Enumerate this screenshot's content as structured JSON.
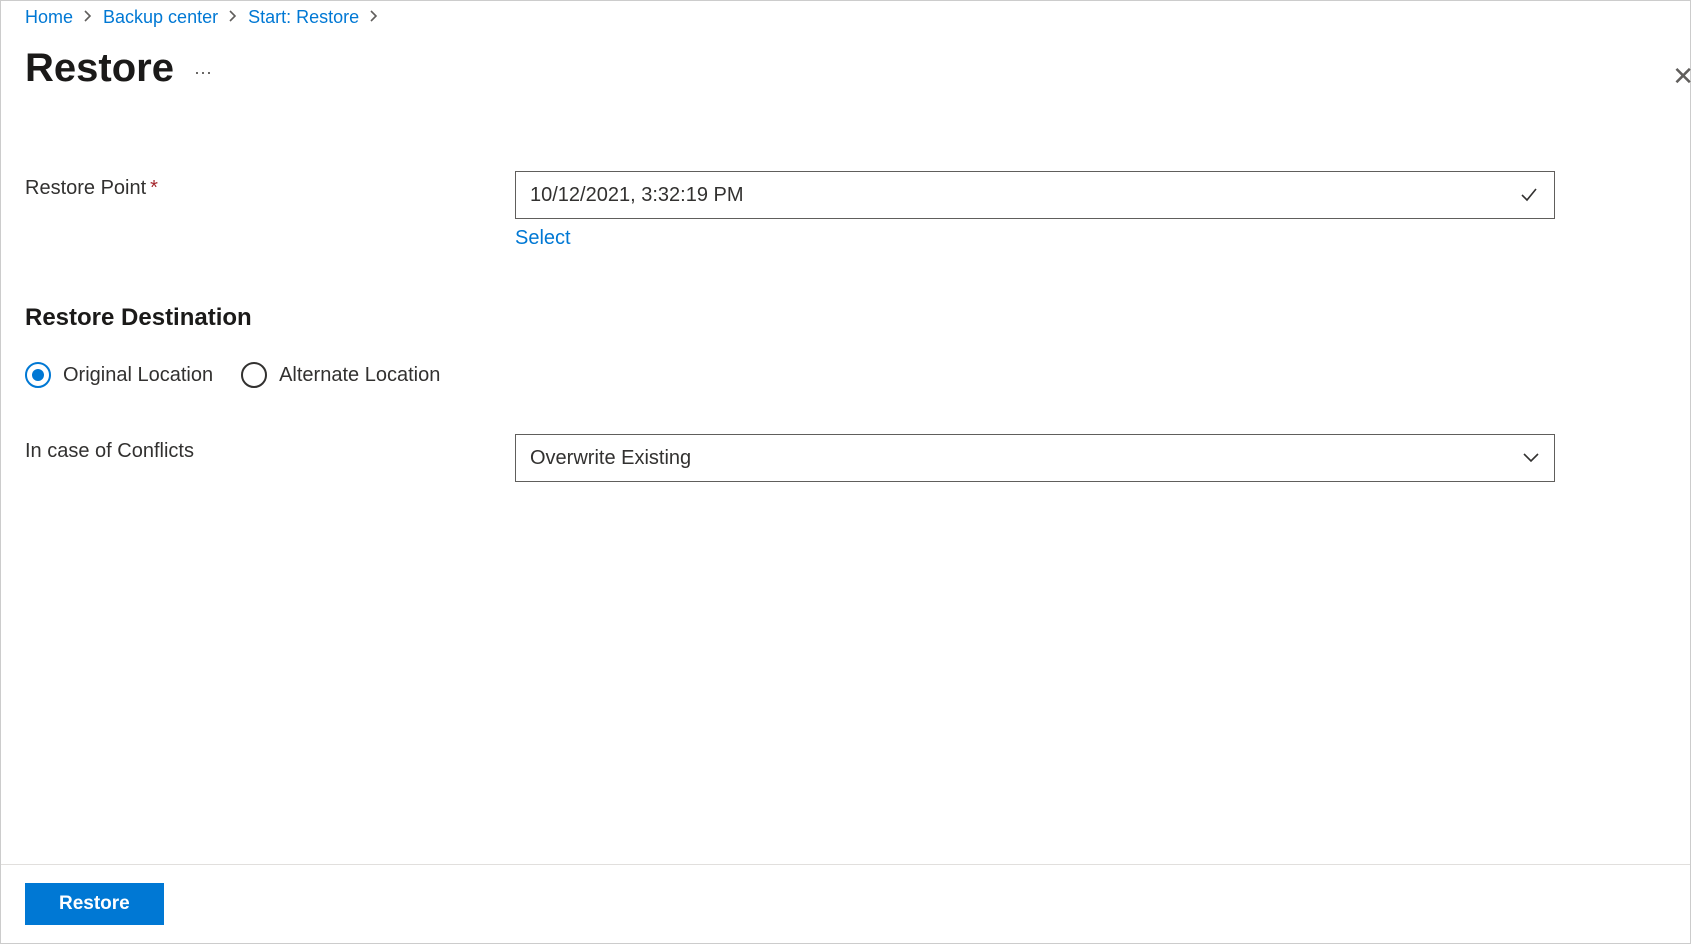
{
  "breadcrumb": {
    "items": [
      "Home",
      "Backup center",
      "Start: Restore"
    ]
  },
  "header": {
    "title": "Restore"
  },
  "form": {
    "restore_point": {
      "label": "Restore Point",
      "value": "10/12/2021, 3:32:19 PM",
      "select_link": "Select"
    },
    "destination": {
      "heading": "Restore Destination",
      "options": {
        "original": "Original Location",
        "alternate": "Alternate Location"
      },
      "selected": "original"
    },
    "conflicts": {
      "label": "In case of Conflicts",
      "value": "Overwrite Existing"
    }
  },
  "footer": {
    "restore_button": "Restore"
  }
}
